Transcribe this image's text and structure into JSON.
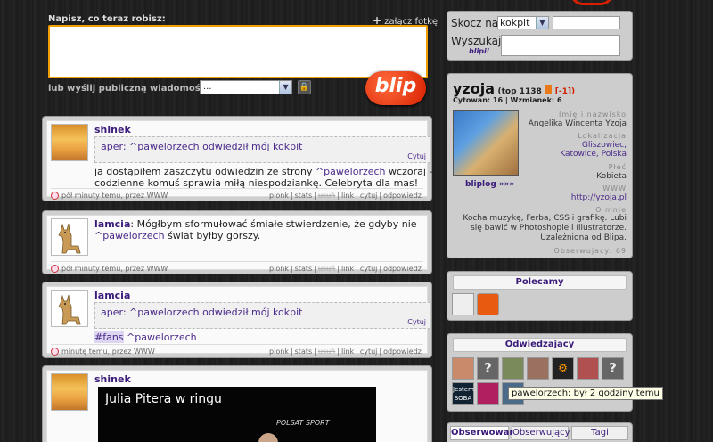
{
  "compose": {
    "label": "Napisz, co teraz robisz:",
    "attach": "załącz fotkę",
    "public_label": "lub wyślij publiczną wiadomość do:",
    "public_value": "...",
    "logo": "blip"
  },
  "sidebar_top": {
    "jump_label": "Skocz na:",
    "jump_value": "kokpit",
    "search_label": "Wyszukaj:",
    "search_logo": "blipi!"
  },
  "profile": {
    "name": "yzoja",
    "top": "(top 1138",
    "badge": "[-1])",
    "cited_label": "Cytowan:",
    "cited": "16",
    "mentions_label": "Wzmianek:",
    "mentions": "6",
    "link": "bliplog »»»",
    "fields": [
      {
        "label": "Imię i nazwisko",
        "value": "Angelika Wincenta Yzoja"
      },
      {
        "label": "Lokalizacja",
        "value": "Gliszowiec, Katowice, Polska"
      },
      {
        "label": "Płeć",
        "value": "Kobieta"
      },
      {
        "label": "WWW",
        "value": "http://yzoja.pl"
      },
      {
        "label": "O mnie",
        "value": "Kocha muzykę, Ferba, CSS i grafikę. Lubi się bawić w Photoshopie i Illustratorze. Uzależniona od Blipa."
      }
    ],
    "observers": "Obserwujacy: 69"
  },
  "recommended": {
    "title": "Polecamy"
  },
  "visitors": {
    "title": "Odwiedzający",
    "tooltip": "pawelorzech: był 2 godziny temu",
    "tile_text": "Jestem SOBĄ"
  },
  "tabs": [
    "Obserwowani",
    "Obserwujący",
    "Tagi"
  ],
  "statuses": [
    {
      "author": "shinek",
      "quote": "aper: ^pawelorzech odwiedził mój kokpit",
      "quote_cite": "Cytuj",
      "text_pre": "ja dostąpiłem zaszczytu odwiedzin ze strony ",
      "mention": "^pawelorzech",
      "text_post": " wczoraj - codzienne komuś sprawia miłą niespodziankę. Celebryta dla mas!",
      "time": "pół minuty temu, przez WWW"
    },
    {
      "author": "lamcia",
      "text_pre": "Mógłbym sformułować śmiałe stwierdzenie, że gdyby nie ",
      "mention": "^pawelorzech",
      "text_post": " świat byłby gorszy.",
      "time": "pół minuty temu, przez WWW"
    },
    {
      "author": "lamcia",
      "quote": "aper: ^pawelorzech odwiedził mój kokpit",
      "quote_cite": "Cytuj",
      "tag": "#fans",
      "mention": "^pawelorzech",
      "time": "minutę temu, przez WWW"
    },
    {
      "author": "shinek",
      "video_title": "Julia Pitera w ringu"
    }
  ],
  "actions": [
    "plonk",
    "stats",
    "usuń",
    "link",
    "cytuj",
    "odpowiedz"
  ]
}
